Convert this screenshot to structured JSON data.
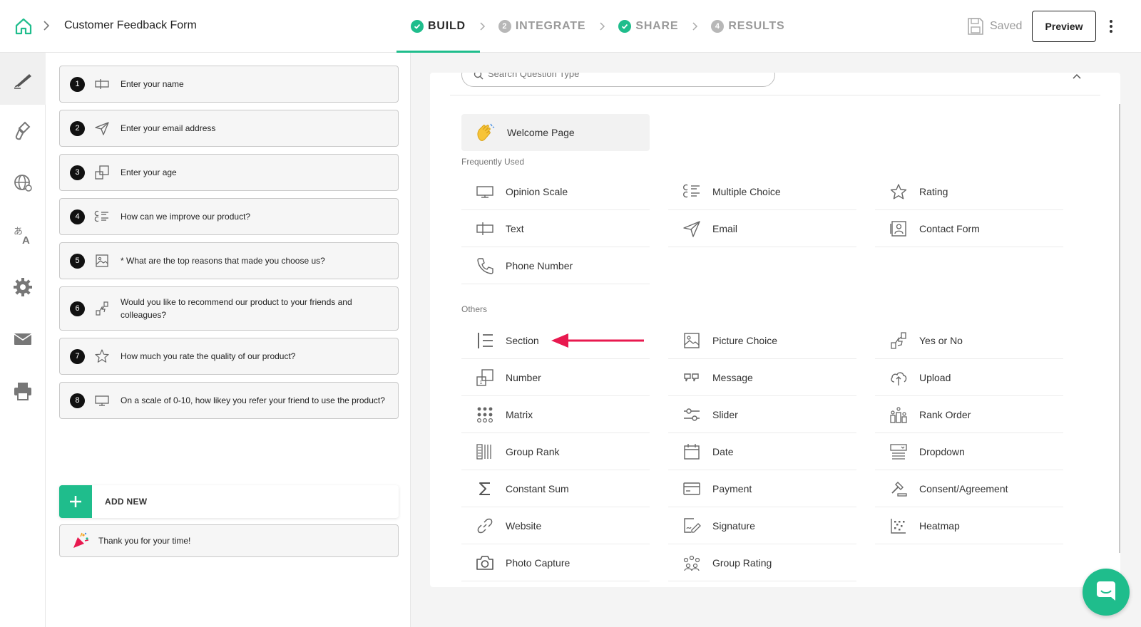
{
  "header": {
    "form_title": "Customer Feedback Form",
    "saved_label": "Saved",
    "preview_label": "Preview"
  },
  "steps": [
    {
      "badge": "",
      "label": "BUILD",
      "state": "done"
    },
    {
      "badge": "2",
      "label": "INTEGRATE",
      "state": "pending"
    },
    {
      "badge": "",
      "label": "SHARE",
      "state": "done"
    },
    {
      "badge": "4",
      "label": "RESULTS",
      "state": "pending"
    }
  ],
  "rail": [
    "pencil-icon",
    "paint-brush-icon",
    "globe-icon",
    "translate-icon",
    "gear-icon",
    "mail-icon",
    "printer-icon"
  ],
  "questions": [
    {
      "num": "1",
      "text": "Enter your name",
      "icon": "text-field-icon"
    },
    {
      "num": "2",
      "text": "Enter your email address",
      "icon": "send-icon"
    },
    {
      "num": "3",
      "text": "Enter your age",
      "icon": "number-icon"
    },
    {
      "num": "4",
      "text": "How can we improve our product?",
      "icon": "multiple-choice-icon"
    },
    {
      "num": "5",
      "text": "* What are the top reasons that made you choose us?",
      "icon": "picture-icon"
    },
    {
      "num": "6",
      "text": "Would you like to recommend our product to your friends and colleagues?",
      "icon": "thumbs-icon"
    },
    {
      "num": "7",
      "text": "How much you rate the quality of our product?",
      "icon": "star-icon"
    },
    {
      "num": "8",
      "text": "On a scale of 0-10, how likey you refer your friend to use the product?",
      "icon": "scale-icon"
    }
  ],
  "add_new_label": "ADD NEW",
  "thank_you_label": "Thank you for your time!",
  "types_panel": {
    "search_placeholder": "Search Question Type",
    "welcome_label": "Welcome Page",
    "frequently_used_label": "Frequently Used",
    "others_label": "Others",
    "frequently_used": [
      {
        "label": "Opinion Scale",
        "icon": "scale-icon"
      },
      {
        "label": "Multiple Choice",
        "icon": "multiple-choice-icon"
      },
      {
        "label": "Rating",
        "icon": "star-icon"
      },
      {
        "label": "Text",
        "icon": "text-field-icon"
      },
      {
        "label": "Email",
        "icon": "send-icon"
      },
      {
        "label": "Contact Form",
        "icon": "contact-card-icon"
      },
      {
        "label": "Phone Number",
        "icon": "phone-icon"
      }
    ],
    "others": [
      {
        "label": "Section",
        "icon": "section-icon"
      },
      {
        "label": "Picture Choice",
        "icon": "picture-icon"
      },
      {
        "label": "Yes or No",
        "icon": "thumbs-icon"
      },
      {
        "label": "Number",
        "icon": "number-icon"
      },
      {
        "label": "Message",
        "icon": "quote-icon"
      },
      {
        "label": "Upload",
        "icon": "cloud-upload-icon"
      },
      {
        "label": "Matrix",
        "icon": "matrix-icon"
      },
      {
        "label": "Slider",
        "icon": "slider-icon"
      },
      {
        "label": "Rank Order",
        "icon": "rank-order-icon"
      },
      {
        "label": "Group Rank",
        "icon": "group-rank-icon"
      },
      {
        "label": "Date",
        "icon": "calendar-icon"
      },
      {
        "label": "Dropdown",
        "icon": "dropdown-icon"
      },
      {
        "label": "Constant Sum",
        "icon": "sigma-icon"
      },
      {
        "label": "Payment",
        "icon": "card-icon"
      },
      {
        "label": "Consent/Agreement",
        "icon": "gavel-icon"
      },
      {
        "label": "Website",
        "icon": "link-icon"
      },
      {
        "label": "Signature",
        "icon": "signature-icon"
      },
      {
        "label": "Heatmap",
        "icon": "heatmap-icon"
      },
      {
        "label": "Photo Capture",
        "icon": "camera-icon"
      },
      {
        "label": "Group Rating",
        "icon": "group-rating-icon"
      }
    ]
  },
  "colors": {
    "accent": "#1fbd8c",
    "arrow": "#e8194f"
  }
}
